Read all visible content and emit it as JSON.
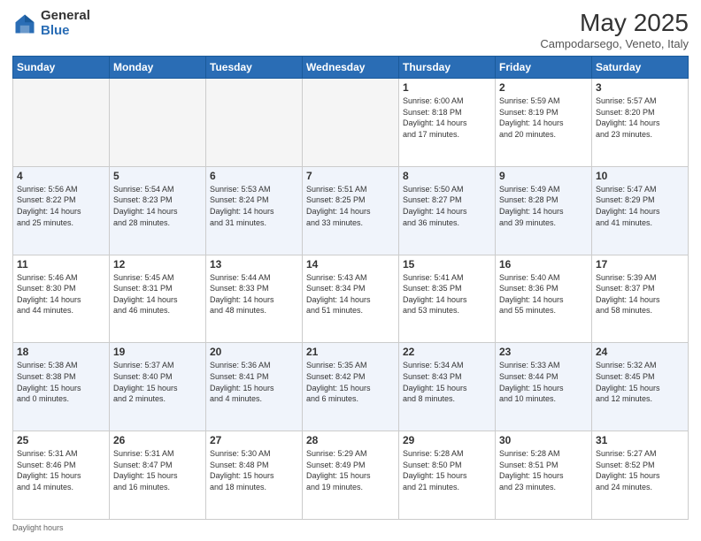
{
  "logo": {
    "general": "General",
    "blue": "Blue"
  },
  "title": "May 2025",
  "subtitle": "Campodarsego, Veneto, Italy",
  "days_of_week": [
    "Sunday",
    "Monday",
    "Tuesday",
    "Wednesday",
    "Thursday",
    "Friday",
    "Saturday"
  ],
  "footer_text": "Daylight hours",
  "weeks": [
    [
      {
        "day": "",
        "info": ""
      },
      {
        "day": "",
        "info": ""
      },
      {
        "day": "",
        "info": ""
      },
      {
        "day": "",
        "info": ""
      },
      {
        "day": "1",
        "info": "Sunrise: 6:00 AM\nSunset: 8:18 PM\nDaylight: 14 hours\nand 17 minutes."
      },
      {
        "day": "2",
        "info": "Sunrise: 5:59 AM\nSunset: 8:19 PM\nDaylight: 14 hours\nand 20 minutes."
      },
      {
        "day": "3",
        "info": "Sunrise: 5:57 AM\nSunset: 8:20 PM\nDaylight: 14 hours\nand 23 minutes."
      }
    ],
    [
      {
        "day": "4",
        "info": "Sunrise: 5:56 AM\nSunset: 8:22 PM\nDaylight: 14 hours\nand 25 minutes."
      },
      {
        "day": "5",
        "info": "Sunrise: 5:54 AM\nSunset: 8:23 PM\nDaylight: 14 hours\nand 28 minutes."
      },
      {
        "day": "6",
        "info": "Sunrise: 5:53 AM\nSunset: 8:24 PM\nDaylight: 14 hours\nand 31 minutes."
      },
      {
        "day": "7",
        "info": "Sunrise: 5:51 AM\nSunset: 8:25 PM\nDaylight: 14 hours\nand 33 minutes."
      },
      {
        "day": "8",
        "info": "Sunrise: 5:50 AM\nSunset: 8:27 PM\nDaylight: 14 hours\nand 36 minutes."
      },
      {
        "day": "9",
        "info": "Sunrise: 5:49 AM\nSunset: 8:28 PM\nDaylight: 14 hours\nand 39 minutes."
      },
      {
        "day": "10",
        "info": "Sunrise: 5:47 AM\nSunset: 8:29 PM\nDaylight: 14 hours\nand 41 minutes."
      }
    ],
    [
      {
        "day": "11",
        "info": "Sunrise: 5:46 AM\nSunset: 8:30 PM\nDaylight: 14 hours\nand 44 minutes."
      },
      {
        "day": "12",
        "info": "Sunrise: 5:45 AM\nSunset: 8:31 PM\nDaylight: 14 hours\nand 46 minutes."
      },
      {
        "day": "13",
        "info": "Sunrise: 5:44 AM\nSunset: 8:33 PM\nDaylight: 14 hours\nand 48 minutes."
      },
      {
        "day": "14",
        "info": "Sunrise: 5:43 AM\nSunset: 8:34 PM\nDaylight: 14 hours\nand 51 minutes."
      },
      {
        "day": "15",
        "info": "Sunrise: 5:41 AM\nSunset: 8:35 PM\nDaylight: 14 hours\nand 53 minutes."
      },
      {
        "day": "16",
        "info": "Sunrise: 5:40 AM\nSunset: 8:36 PM\nDaylight: 14 hours\nand 55 minutes."
      },
      {
        "day": "17",
        "info": "Sunrise: 5:39 AM\nSunset: 8:37 PM\nDaylight: 14 hours\nand 58 minutes."
      }
    ],
    [
      {
        "day": "18",
        "info": "Sunrise: 5:38 AM\nSunset: 8:38 PM\nDaylight: 15 hours\nand 0 minutes."
      },
      {
        "day": "19",
        "info": "Sunrise: 5:37 AM\nSunset: 8:40 PM\nDaylight: 15 hours\nand 2 minutes."
      },
      {
        "day": "20",
        "info": "Sunrise: 5:36 AM\nSunset: 8:41 PM\nDaylight: 15 hours\nand 4 minutes."
      },
      {
        "day": "21",
        "info": "Sunrise: 5:35 AM\nSunset: 8:42 PM\nDaylight: 15 hours\nand 6 minutes."
      },
      {
        "day": "22",
        "info": "Sunrise: 5:34 AM\nSunset: 8:43 PM\nDaylight: 15 hours\nand 8 minutes."
      },
      {
        "day": "23",
        "info": "Sunrise: 5:33 AM\nSunset: 8:44 PM\nDaylight: 15 hours\nand 10 minutes."
      },
      {
        "day": "24",
        "info": "Sunrise: 5:32 AM\nSunset: 8:45 PM\nDaylight: 15 hours\nand 12 minutes."
      }
    ],
    [
      {
        "day": "25",
        "info": "Sunrise: 5:31 AM\nSunset: 8:46 PM\nDaylight: 15 hours\nand 14 minutes."
      },
      {
        "day": "26",
        "info": "Sunrise: 5:31 AM\nSunset: 8:47 PM\nDaylight: 15 hours\nand 16 minutes."
      },
      {
        "day": "27",
        "info": "Sunrise: 5:30 AM\nSunset: 8:48 PM\nDaylight: 15 hours\nand 18 minutes."
      },
      {
        "day": "28",
        "info": "Sunrise: 5:29 AM\nSunset: 8:49 PM\nDaylight: 15 hours\nand 19 minutes."
      },
      {
        "day": "29",
        "info": "Sunrise: 5:28 AM\nSunset: 8:50 PM\nDaylight: 15 hours\nand 21 minutes."
      },
      {
        "day": "30",
        "info": "Sunrise: 5:28 AM\nSunset: 8:51 PM\nDaylight: 15 hours\nand 23 minutes."
      },
      {
        "day": "31",
        "info": "Sunrise: 5:27 AM\nSunset: 8:52 PM\nDaylight: 15 hours\nand 24 minutes."
      }
    ]
  ]
}
